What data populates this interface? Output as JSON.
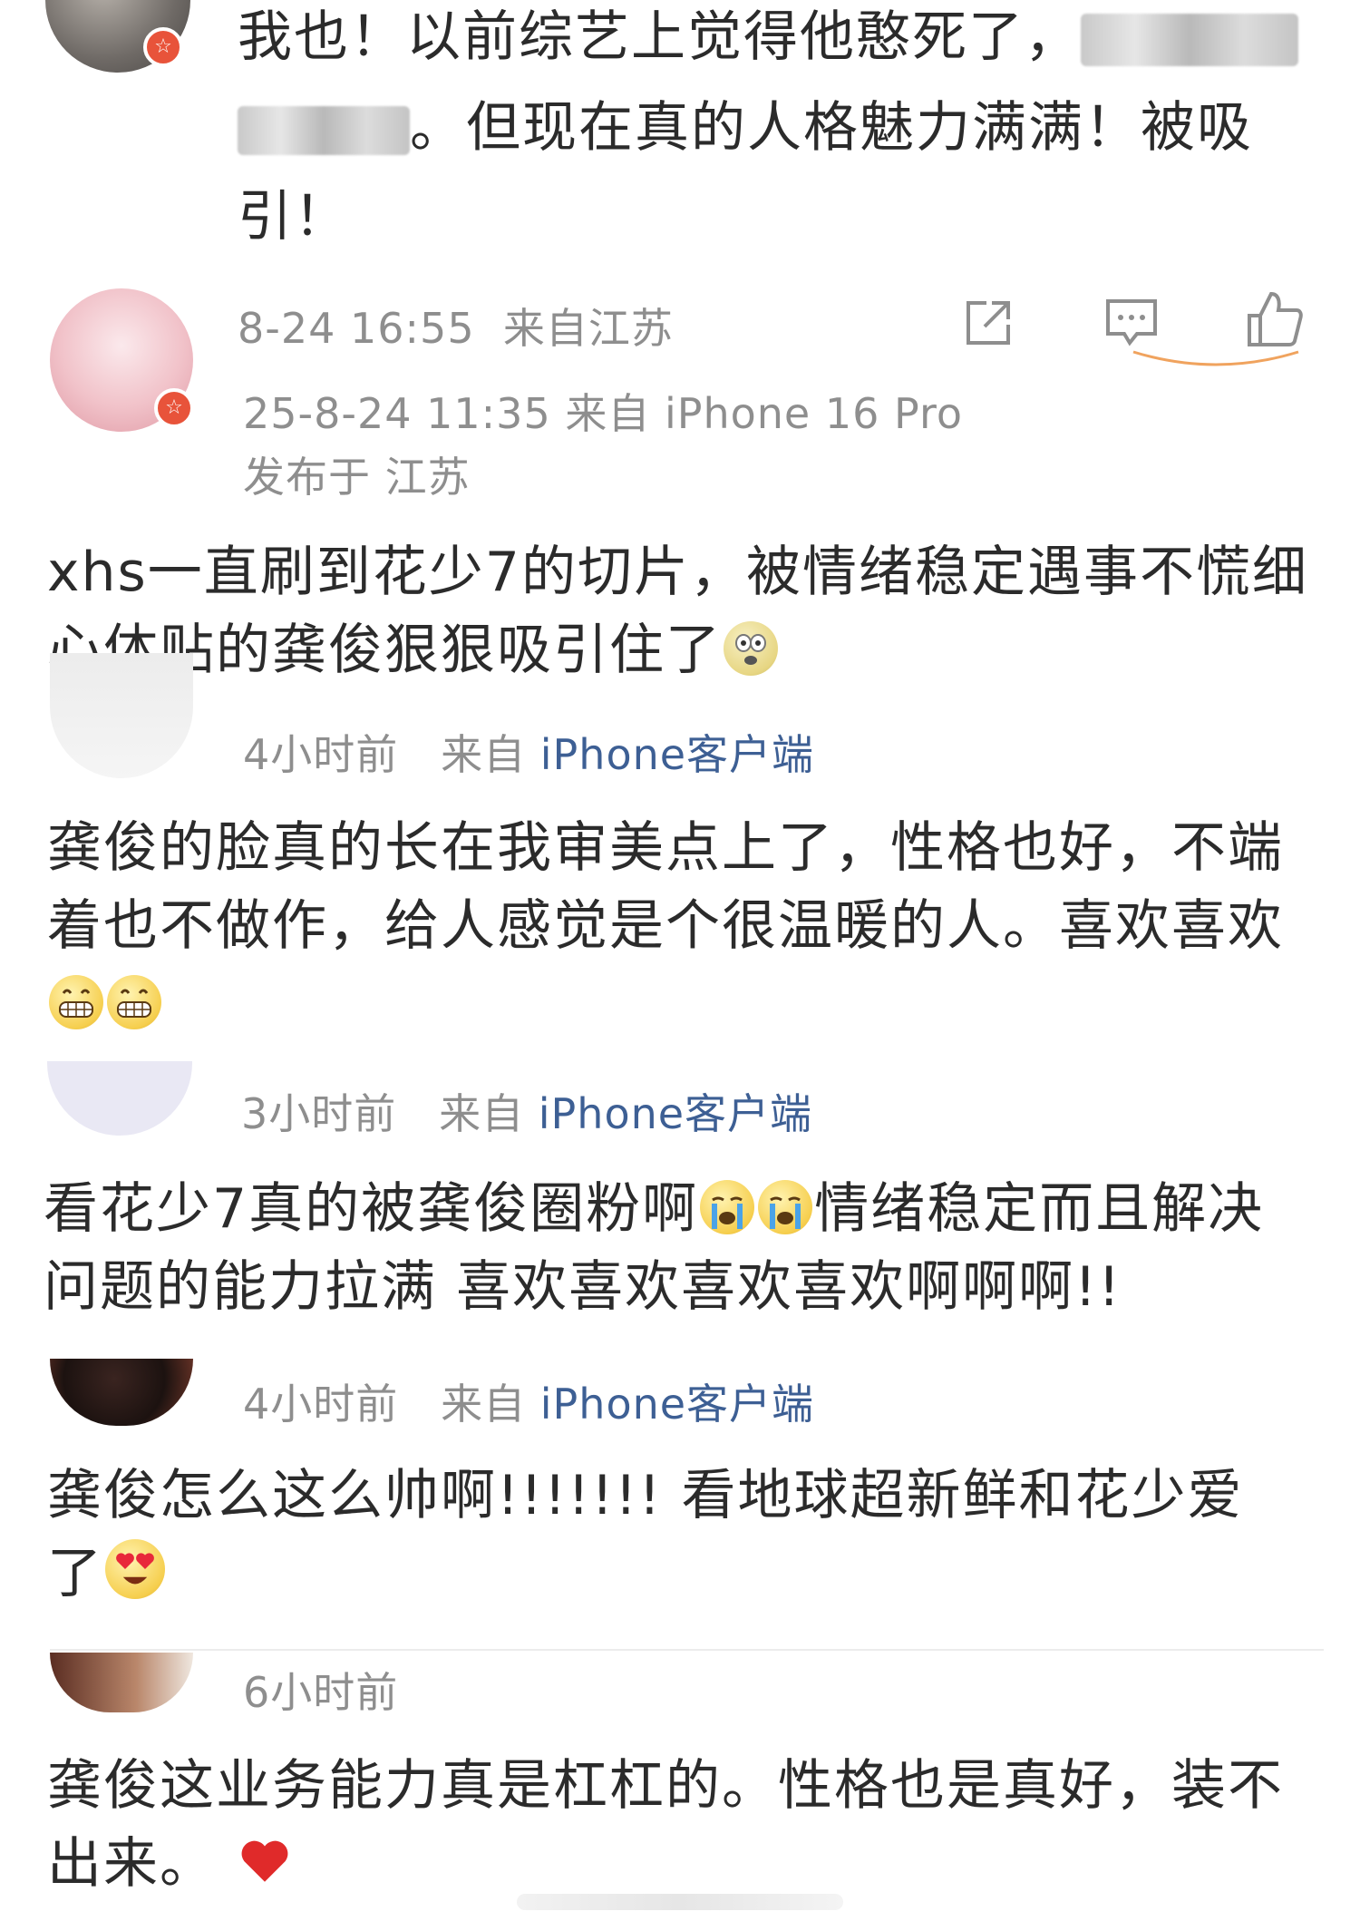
{
  "top_comment": {
    "line1_visible": "我也！以前综艺上觉得他憨死了，",
    "line2_suffix": "。但现在真的人格魅力满满！被吸",
    "line3": "引！",
    "timestamp": "8-24 16:55",
    "location": "来自江苏"
  },
  "post": {
    "time_device": "25-8-24 11:35  来自 iPhone 16 Pro",
    "location": "发布于 江苏",
    "line1": "xhs一直刷到花少7的切片，被情绪稳定遇事不慌细",
    "line2": "心体贴的龚俊狠狠吸引住了"
  },
  "comments": [
    {
      "time": "4小时前",
      "from": "来自",
      "source": "iPhone客户端",
      "line1": "龚俊的脸真的长在我审美点上了，性格也好，不端",
      "line2": "着也不做作，给人感觉是个很温暖的人。喜欢喜欢"
    },
    {
      "time": "3小时前",
      "from": "来自",
      "source": "iPhone客户端",
      "line1a": "看花少7真的被龚俊圈粉啊",
      "line1b": "情绪稳定而且解决",
      "line2": "问题的能力拉满 喜欢喜欢喜欢喜欢啊啊啊!!"
    },
    {
      "time": "4小时前",
      "from": "来自",
      "source": "iPhone客户端",
      "line1": "龚俊怎么这么帅啊!!!!!!! 看地球超新鲜和花少爱",
      "line2": "了"
    },
    {
      "time": "6小时前",
      "line1": "龚俊这业务能力真是杠杠的。性格也是真好，装不",
      "line2": "出来。"
    }
  ],
  "colors": {
    "meta_gray": "#8e8e8e",
    "source_blue": "#3d5f94",
    "badge_red": "#e8533a",
    "like_orange": "#f0a35e"
  }
}
